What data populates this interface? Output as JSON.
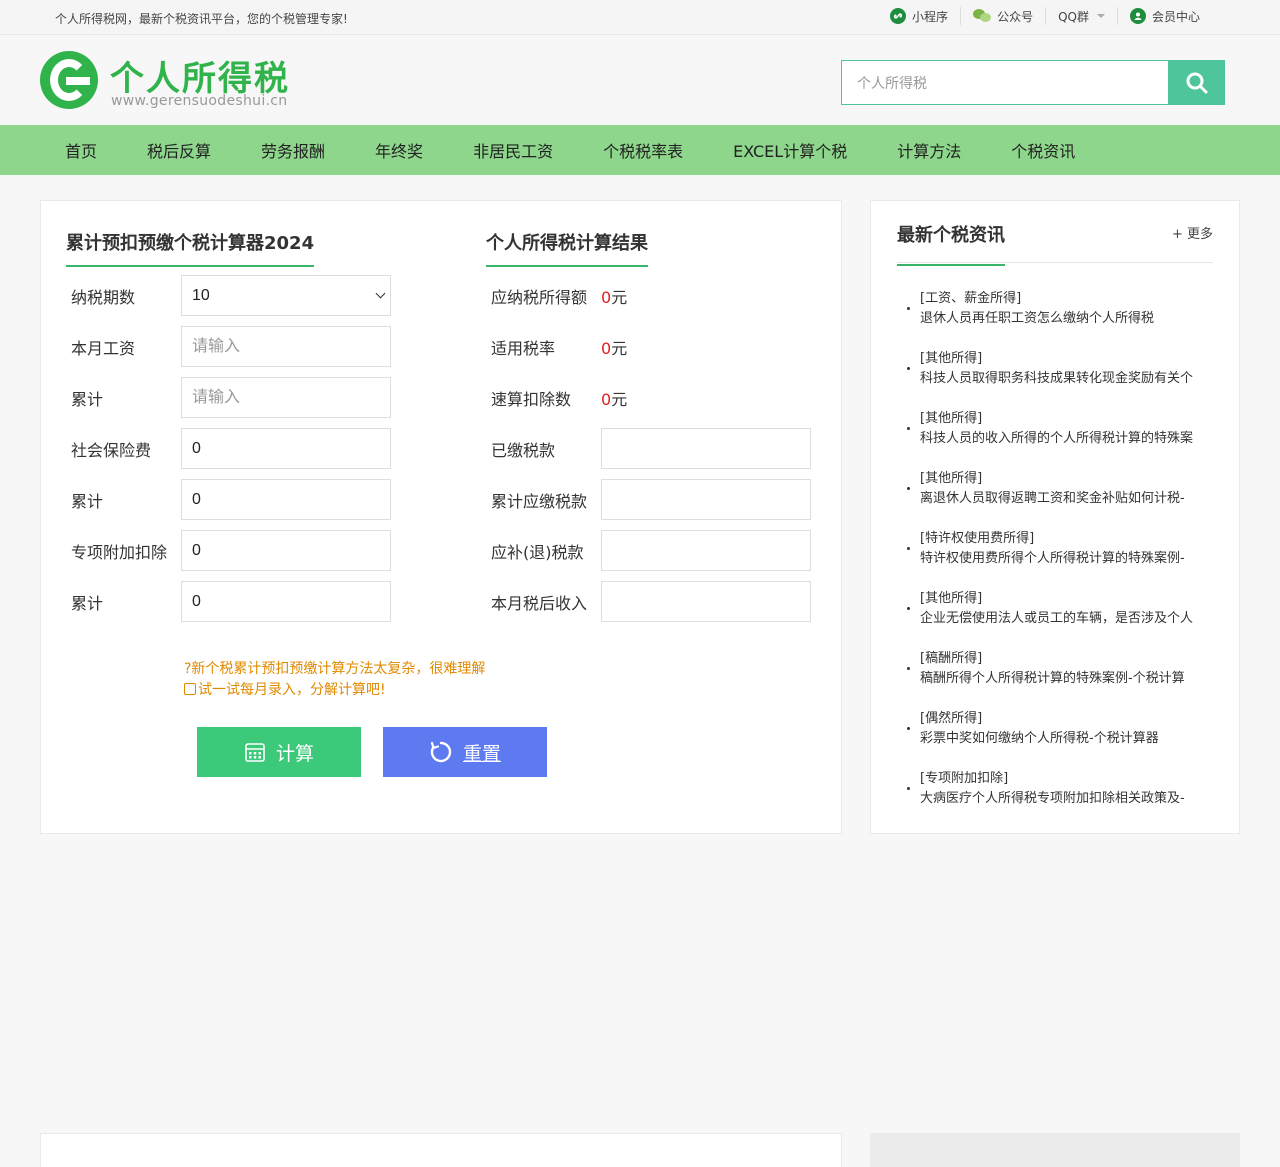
{
  "topbar": {
    "slogan": "个人所得税网，最新个税资讯平台，您的个税管理专家!",
    "links": [
      {
        "label": "小程序",
        "icon": "mini-program-icon"
      },
      {
        "label": "公众号",
        "icon": "wechat-icon"
      },
      {
        "label": "QQ群",
        "icon": "chevron-down-icon"
      },
      {
        "label": "会员中心",
        "icon": "user-icon"
      }
    ]
  },
  "header": {
    "logo_title": "个人所得税",
    "logo_url": "www.gerensuodeshui.cn",
    "search_placeholder": "个人所得税"
  },
  "nav": [
    "首页",
    "税后反算",
    "劳务报酬",
    "年终奖",
    "非居民工资",
    "个税税率表",
    "EXCEL计算个税",
    "计算方法",
    "个税资讯"
  ],
  "calculator": {
    "title": "累计预扣预缴个税计算器2024",
    "period_label": "纳税期数",
    "period_value": "10",
    "salary_label": "本月工资",
    "salary_placeholder": "请输入",
    "salary_cum_label": "累计",
    "salary_cum_placeholder": "请输入",
    "insurance_label": "社会保险费",
    "insurance_value": "0",
    "insurance_cum_label": "累计",
    "insurance_cum_value": "0",
    "deduction_label": "专项附加扣除",
    "deduction_value": "0",
    "deduction_cum_label": "累计",
    "deduction_cum_value": "0",
    "tip1": "?新个税累计预扣预缴计算方法太复杂，很难理解",
    "tip2": "试一试每月录入，分解计算吧!",
    "calc_label": "计算",
    "reset_label": "重置"
  },
  "result": {
    "title": "个人所得税计算结果",
    "taxable_label": "应纳税所得额",
    "taxable_num": "0",
    "taxable_unit": "元",
    "rate_label": "适用税率",
    "rate_num": "0",
    "rate_unit": "元",
    "quick_label": "速算扣除数",
    "quick_num": "0",
    "quick_unit": "元",
    "paid_label": "已缴税款",
    "cum_due_label": "累计应缴税款",
    "refund_label": "应补(退)税款",
    "after_tax_label": "本月税后收入"
  },
  "news": {
    "title": "最新个税资讯",
    "more": "+ 更多",
    "items": [
      {
        "cat": "[工资、薪金所得]",
        "title": "退休人员再任职工资怎么缴纳个人所得税"
      },
      {
        "cat": "[其他所得]",
        "title": "科技人员取得职务科技成果转化现金奖励有关个"
      },
      {
        "cat": "[其他所得]",
        "title": "科技人员的收入所得的个人所得税计算的特殊案"
      },
      {
        "cat": "[其他所得]",
        "title": "离退休人员取得返聘工资和奖金补贴如何计税-"
      },
      {
        "cat": "[特许权使用费所得]",
        "title": "特许权使用费所得个人所得税计算的特殊案例-"
      },
      {
        "cat": "[其他所得]",
        "title": "企业无偿使用法人或员工的车辆，是否涉及个人"
      },
      {
        "cat": "[稿酬所得]",
        "title": "稿酬所得个人所得税计算的特殊案例-个税计算"
      },
      {
        "cat": "[偶然所得]",
        "title": "彩票中奖如何缴纳个人所得税-个税计算器"
      },
      {
        "cat": "[专项附加扣除]",
        "title": "大病医疗个人所得税专项附加扣除相关政策及-"
      }
    ]
  },
  "colors": {
    "brand_green": "#2fb34a",
    "nav_green": "#8dd68b",
    "search_teal": "#4fc59b",
    "calc_button": "#3cc97a",
    "reset_button": "#5d7af0",
    "tip_orange": "#e08a00",
    "result_red": "#e02020"
  }
}
